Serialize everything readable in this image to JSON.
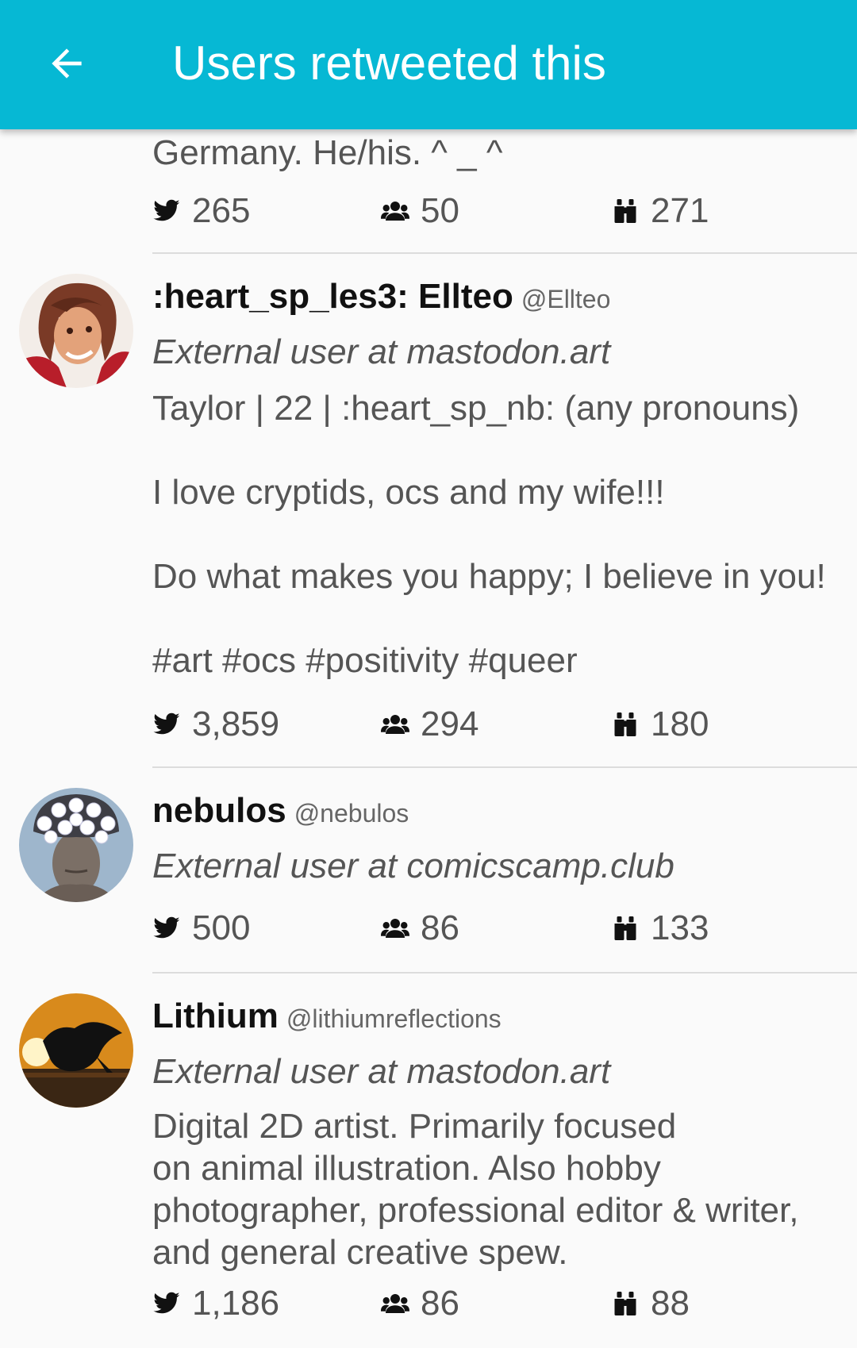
{
  "appbar": {
    "title": "Users retweeted this",
    "back_icon": "arrow-left-icon",
    "background": "#06b8d4"
  },
  "users": [
    {
      "bio": "Germany. He/his.  ^ _ ^",
      "stats": {
        "tweets": "265",
        "followers": "50",
        "following": "271"
      }
    },
    {
      "name": ":heart_sp_les3:  Ellteo",
      "handle": "@Ellteo",
      "external": "External user at mastodon.art",
      "bio": "Taylor | 22 | :heart_sp_nb: (any pronouns)\n\nI love cryptids, ocs and my wife!!!\n\nDo what makes you happy; I believe in you!\n\n#art #ocs #positivity #queer",
      "stats": {
        "tweets": "3,859",
        "followers": "294",
        "following": "180"
      }
    },
    {
      "name": "nebulos",
      "handle": "@nebulos",
      "external": "External user at comicscamp.club",
      "stats": {
        "tweets": "500",
        "followers": "86",
        "following": "133"
      }
    },
    {
      "name": "Lithium",
      "handle": "@lithiumreflections",
      "external": "External user at mastodon.art",
      "bio": "Digital 2D artist. Primarily focused\non animal illustration. Also hobby\nphotographer, professional editor & writer,\nand general creative spew.",
      "stats": {
        "tweets": "1,186",
        "followers": "86",
        "following": "88"
      }
    }
  ],
  "icons": {
    "tweets": "bird-icon",
    "followers": "people-icon",
    "following": "binoculars-icon"
  }
}
